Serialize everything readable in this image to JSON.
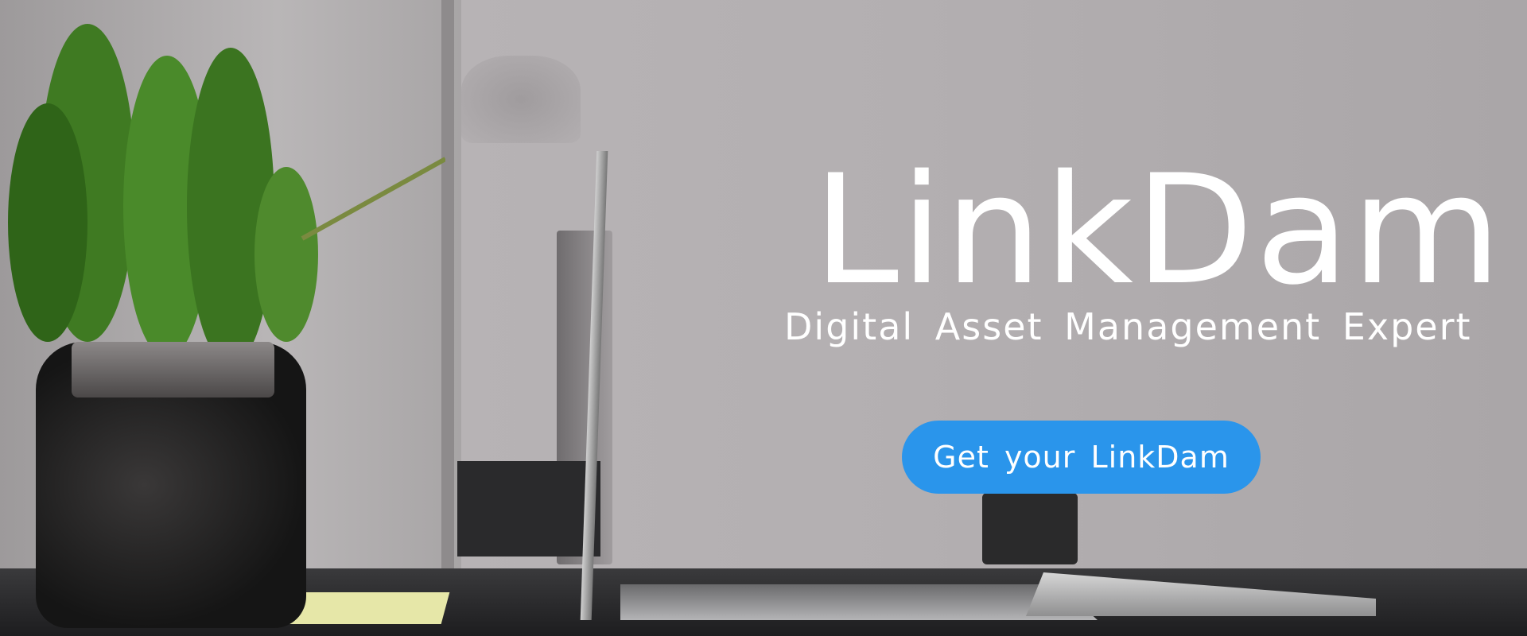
{
  "hero": {
    "title": "LinkDam",
    "subtitle": "Digital Asset Management Expert",
    "cta_label": "Get your LinkDam",
    "cta_color": "#2a95eb"
  }
}
